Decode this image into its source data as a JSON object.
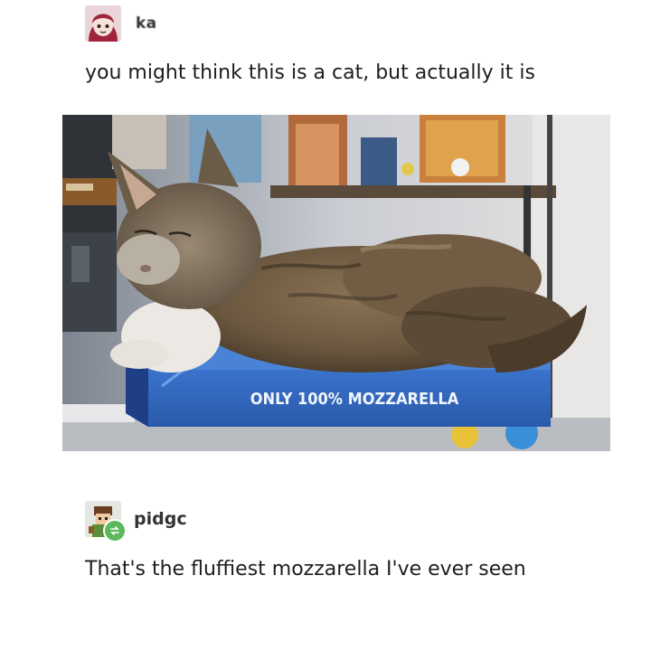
{
  "original_post": {
    "username": "ka",
    "avatar_icon": "anime-girl-avatar-icon",
    "text": "you might think this is a cat, but actually it is"
  },
  "photo": {
    "box_text": "ONLY 100% MOZZARELLA",
    "box_color": "#2f63b8"
  },
  "reply": {
    "username": "pidgc",
    "avatar_icon": "pixel-character-avatar-icon",
    "badge_icon": "reblog-icon",
    "badge_color": "#5cb85c",
    "text": "That's the fluffiest mozzarella I've ever seen"
  }
}
